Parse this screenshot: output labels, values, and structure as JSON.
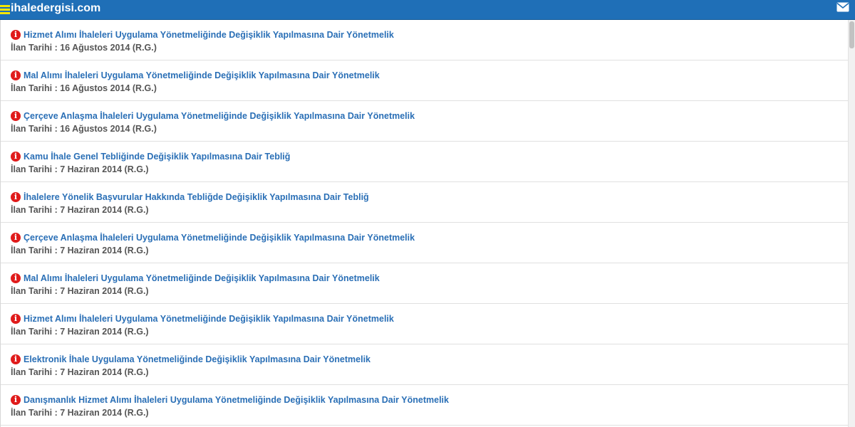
{
  "header": {
    "site_title": "ihaledergisi.com",
    "menu_icon": "hamburger-menu-icon",
    "mail_icon": "envelope-icon",
    "colors": {
      "bar": "#1f6fb7",
      "menu_icon": "#f3e600"
    }
  },
  "items": [
    {
      "title": "Hizmet Alımı İhaleleri Uygulama Yönetmeliğinde Değişiklik Yapılmasına Dair Yönetmelik",
      "date": "İlan Tarihi : 16 Ağustos 2014 (R.G.)"
    },
    {
      "title": "Mal Alımı İhaleleri Uygulama Yönetmeliğinde Değişiklik Yapılmasına Dair Yönetmelik",
      "date": "İlan Tarihi : 16 Ağustos 2014 (R.G.)"
    },
    {
      "title": "Çerçeve Anlaşma İhaleleri Uygulama Yönetmeliğinde Değişiklik Yapılmasına Dair Yönetmelik",
      "date": "İlan Tarihi : 16 Ağustos 2014 (R.G.)"
    },
    {
      "title": "Kamu İhale Genel Tebliğinde Değişiklik Yapılmasına Dair Tebliğ",
      "date": "İlan Tarihi : 7 Haziran 2014 (R.G.)"
    },
    {
      "title": "İhalelere Yönelik Başvurular Hakkında Tebliğde Değişiklik Yapılmasına Dair Tebliğ",
      "date": "İlan Tarihi : 7 Haziran 2014 (R.G.)"
    },
    {
      "title": "Çerçeve Anlaşma İhaleleri Uygulama Yönetmeliğinde Değişiklik Yapılmasına Dair Yönetmelik",
      "date": "İlan Tarihi : 7 Haziran 2014 (R.G.)"
    },
    {
      "title": "Mal Alımı İhaleleri Uygulama Yönetmeliğinde Değişiklik Yapılmasına Dair Yönetmelik",
      "date": "İlan Tarihi : 7 Haziran 2014 (R.G.)"
    },
    {
      "title": "Hizmet Alımı İhaleleri Uygulama Yönetmeliğinde Değişiklik Yapılmasına Dair Yönetmelik",
      "date": "İlan Tarihi : 7 Haziran 2014 (R.G.)"
    },
    {
      "title": "Elektronik İhale Uygulama Yönetmeliğinde Değişiklik Yapılmasına Dair Yönetmelik",
      "date": "İlan Tarihi : 7 Haziran 2014 (R.G.)"
    },
    {
      "title": "Danışmanlık Hizmet Alımı İhaleleri Uygulama Yönetmeliğinde Değişiklik Yapılmasına Dair Yönetmelik",
      "date": "İlan Tarihi : 7 Haziran 2014 (R.G.)"
    }
  ],
  "item_icon": "info-icon",
  "colors": {
    "title_link": "#2a6fb6",
    "date_text": "#555555",
    "info_icon": "#e01b1b"
  }
}
